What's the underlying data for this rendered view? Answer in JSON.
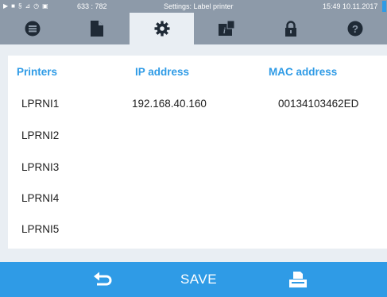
{
  "status": {
    "counter": "633 : 782",
    "title": "Settings: Label printer",
    "datetime": "15:49  10.11.2017",
    "indicator_color": "#2f9be6"
  },
  "tabs": [
    {
      "icon": "list-icon",
      "active": false
    },
    {
      "icon": "document-icon",
      "active": false
    },
    {
      "icon": "gear-icon",
      "active": true
    },
    {
      "icon": "info-icon",
      "active": false
    },
    {
      "icon": "lock-icon",
      "active": false
    },
    {
      "icon": "help-icon",
      "active": false
    }
  ],
  "table": {
    "headers": {
      "printers": "Printers",
      "ip": "IP address",
      "mac": "MAC address"
    },
    "rows": [
      {
        "printer": "LPRNI1",
        "ip": "192.168.40.160",
        "mac": "00134103462ED"
      },
      {
        "printer": "LPRNI2",
        "ip": "",
        "mac": ""
      },
      {
        "printer": "LPRNI3",
        "ip": "",
        "mac": ""
      },
      {
        "printer": "LPRNI4",
        "ip": "",
        "mac": ""
      },
      {
        "printer": "LPRNI5",
        "ip": "",
        "mac": ""
      }
    ]
  },
  "footer": {
    "back_icon": "back-arrow-icon",
    "save_label": "SAVE",
    "printer_icon": "printer-icon"
  },
  "colors": {
    "accent": "#2f9be6",
    "bar": "#8d9aa9",
    "dark_icon": "#1f2a36"
  }
}
